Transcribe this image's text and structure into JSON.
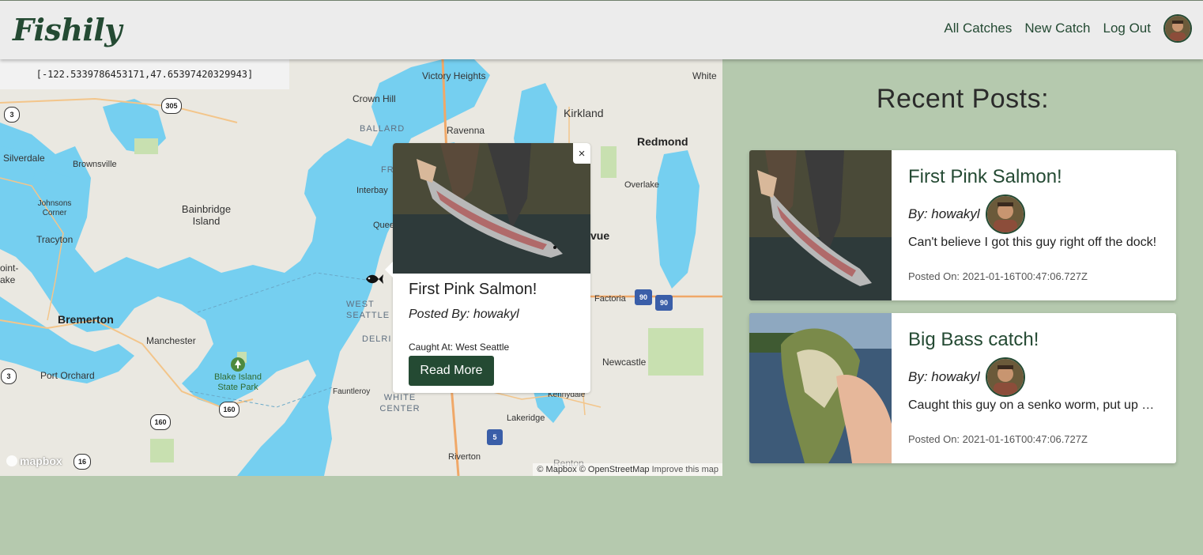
{
  "brand": "Fishily",
  "nav": {
    "all_catches": "All Catches",
    "new_catch": "New Catch",
    "log_out": "Log Out",
    "avatar_icon": "user-avatar-icon"
  },
  "map": {
    "coordinates": "[-122.5339786453171,47.65397420329943]",
    "labels": {
      "victory_heights": "Victory Heights",
      "white": "White",
      "crown_hill": "Crown Hill",
      "kirkland": "Kirkland",
      "ballard": "BALLARD",
      "ravenna": "Ravenna",
      "redmond": "Redmond",
      "silverdale": "Silverdale",
      "brownsville": "Brownsville",
      "fre": "FRE",
      "overlake": "Overlake",
      "interbay": "Interbay",
      "johnsons_corner": "Johnsons Corner",
      "bainbridge_island": "Bainbridge Island",
      "quee": "Quee",
      "tracyton": "Tracyton",
      "vue": "vue",
      "point": "oint-",
      "lake": "ake",
      "west_seattle": "WEST SEATTLE",
      "factoria": "Factoria",
      "bremerton": "Bremerton",
      "delri": "DELRI",
      "manchester": "Manchester",
      "newcastle": "Newcastle",
      "port_orchard": "Port Orchard",
      "blake_island": "Blake Island State Park",
      "fauntleroy": "Fauntleroy",
      "kennydale": "Kennydale",
      "white_center": "WHITE CENTER",
      "lakeridge": "Lakeridge",
      "riverton": "Riverton",
      "renton": "Renton"
    },
    "shields": {
      "r305": "305",
      "r3a": "3",
      "r3b": "3",
      "r90a": "90",
      "r90b": "90",
      "r160a": "160",
      "r160b": "160",
      "r5": "5",
      "r16": "16"
    },
    "logo": "mapbox",
    "attribution_mapbox": "© Mapbox",
    "attribution_osm": "© OpenStreetMap",
    "improve": "Improve this map",
    "marker_icon": "fish-icon",
    "colors": {
      "water": "#75cff0",
      "land": "#eae8e1",
      "park": "#c8e0b0"
    }
  },
  "popup": {
    "close": "×",
    "title": "First Pink Salmon!",
    "posted_by": "Posted By: howakyl",
    "caught_at": "Caught At: West Seattle",
    "read_more": "Read More"
  },
  "recent": {
    "heading": "Recent Posts:",
    "posts": [
      {
        "title": "First Pink Salmon!",
        "by": "By: howakyl",
        "body": "Can't believe I got this guy right off the dock!",
        "date": "Posted On: 2021-01-16T00:47:06.727Z"
      },
      {
        "title": "Big Bass catch!",
        "by": "By: howakyl",
        "body": "Caught this guy on a senko worm, put up a great fight",
        "date": "Posted On: 2021-01-16T00:47:06.727Z"
      }
    ]
  },
  "accent_color": "#244a33",
  "background_color": "#b5c9ae"
}
